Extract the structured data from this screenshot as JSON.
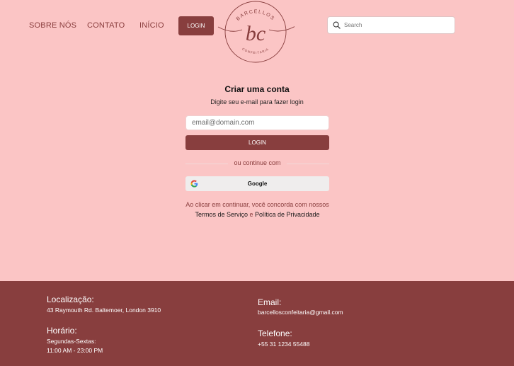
{
  "nav": {
    "about": "SOBRE NÓS",
    "contact": "CONTATO",
    "home": "INÍCIO",
    "login": "LOGIN"
  },
  "logo": {
    "top_text": "BARCELLOS",
    "monogram": "bc",
    "bottom_text": "CONFEITARIA",
    "color": "#883e3e"
  },
  "search": {
    "placeholder": "Search",
    "value": ""
  },
  "form": {
    "title": "Criar uma conta",
    "subtitle": "Digite seu e-mail para fazer login",
    "email_placeholder": "email@domain.com",
    "login_label": "LOGIN",
    "divider_text": "ou continue com",
    "google_label": "Google",
    "terms_prefix": "Ao clicar em continuar, você concorda com nossos ",
    "terms_link": "Termos de Serviço",
    "terms_and": " e ",
    "privacy_link": "Política de Privacidade"
  },
  "footer": {
    "location_title": "Localização:",
    "location_value": "43 Raymouth Rd. Baltemoer, London 3910",
    "hours_title": "Horário:",
    "hours_days": "Segundas-Sextas:",
    "hours_time": "11:00 AM - 23:00 PM",
    "email_title": "Email:",
    "email_value": "barcellosconfeitaria@gmail.com",
    "phone_title": "Telefone:",
    "phone_value": "+55 31 1234 55488"
  },
  "colors": {
    "background": "#fbc5c5",
    "accent": "#883e3e"
  },
  "icons": [
    "search-icon",
    "google-icon"
  ]
}
